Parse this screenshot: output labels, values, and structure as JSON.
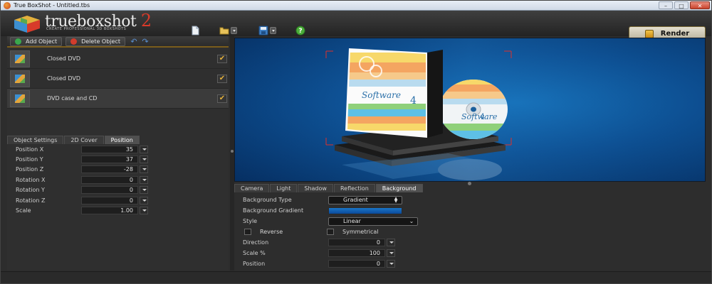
{
  "window": {
    "title": "True BoxShot - Untitled.tbs",
    "minimize": "–",
    "maximize": "□",
    "close": "✕"
  },
  "logo": {
    "word1": "true",
    "word2": "boxshot",
    "version": "2",
    "tagline": "CREATE PROFESSIONAL 3D BOXSHOTS"
  },
  "toolbar": {
    "icons": [
      "new-document-icon",
      "open-folder-icon",
      "save-disk-icon",
      "help-icon"
    ]
  },
  "render": {
    "label": "Render",
    "icon": "render-icon"
  },
  "objects": {
    "add_label": "Add Object",
    "delete_label": "Delete Object",
    "items": [
      {
        "label": "Closed DVD",
        "checked": "✔"
      },
      {
        "label": "Closed DVD",
        "checked": "✔"
      },
      {
        "label": "DVD case and CD",
        "checked": "✔"
      }
    ]
  },
  "left_tabs": [
    "Object Settings",
    "2D Cover",
    "Position"
  ],
  "position": {
    "rows": [
      {
        "label": "Position X",
        "value": "35"
      },
      {
        "label": "Position Y",
        "value": "37"
      },
      {
        "label": "Position Z",
        "value": "-28"
      },
      {
        "label": "Rotation X",
        "value": "0"
      },
      {
        "label": "Rotation Y",
        "value": "0"
      },
      {
        "label": "Rotation Z",
        "value": "0"
      },
      {
        "label": "Scale",
        "value": "1.00"
      }
    ]
  },
  "right_tabs": [
    "Camera",
    "Light",
    "Shadow",
    "Reflection",
    "Background"
  ],
  "background": {
    "type_label": "Background Type",
    "type_value": "Gradient",
    "gradient_label": "Background Gradient",
    "style_label": "Style",
    "style_value": "Linear",
    "reverse_label": "Reverse",
    "symmetrical_label": "Symmetrical",
    "direction_label": "Direction",
    "direction_value": "0",
    "scale_label": "Scale %",
    "scale_value": "100",
    "position_label": "Position",
    "position_value": "0"
  },
  "viewport": {
    "cover_text": "Software",
    "cover_number": "4"
  },
  "colors": {
    "accent": "#d83a2a",
    "viewport_bg": "#0d4f92",
    "selection": "#e3b03c"
  }
}
